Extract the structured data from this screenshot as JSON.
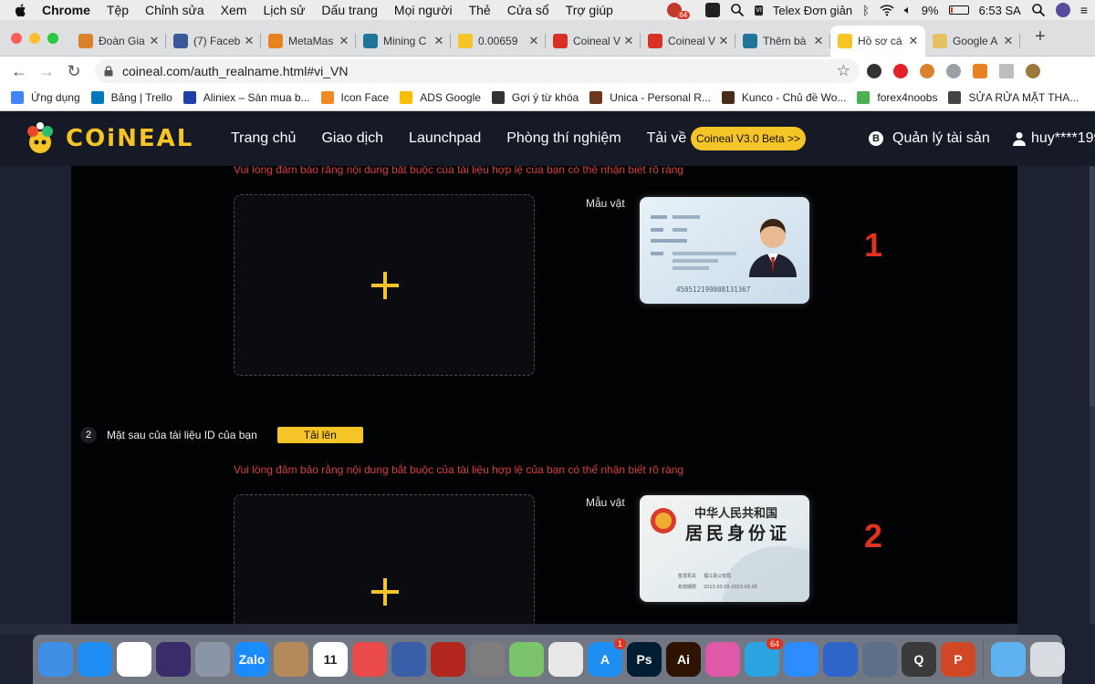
{
  "menubar": {
    "app_name": "Chrome",
    "items": [
      "Tệp",
      "Chỉnh sửa",
      "Xem",
      "Lịch sử",
      "Dấu trang",
      "Mọi người",
      "Thẻ",
      "Cửa sổ",
      "Trợ giúp"
    ],
    "notification_badge": "64",
    "input_method": "Telex Đơn giản",
    "input_badge": "VI",
    "battery": "9%",
    "clock": "6:53 SA"
  },
  "tabs": [
    {
      "title": "Đoàn Gia",
      "icon": "trello-icon",
      "color": "#d9822b",
      "active": false
    },
    {
      "title": "(7) Faceb",
      "icon": "facebook-icon",
      "color": "#3b5998",
      "active": false
    },
    {
      "title": "MetaMas",
      "icon": "metamask-icon",
      "color": "#e8821e",
      "active": false
    },
    {
      "title": "Mining C",
      "icon": "wordpress-icon",
      "color": "#21759b",
      "active": false
    },
    {
      "title": "0.00659",
      "icon": "bolt-icon",
      "color": "#f5c426",
      "active": false
    },
    {
      "title": "Coineal V",
      "icon": "gmail-icon",
      "color": "#d93025",
      "active": false
    },
    {
      "title": "Coineal V",
      "icon": "gmail-icon",
      "color": "#d93025",
      "active": false
    },
    {
      "title": "Thêm bà",
      "icon": "wordpress-icon",
      "color": "#21759b",
      "active": false
    },
    {
      "title": "Hồ sơ cá",
      "icon": "bolt-icon",
      "color": "#f5c426",
      "active": true
    },
    {
      "title": "Google A",
      "icon": "google-ads-icon",
      "color": "#e6c063",
      "active": false
    }
  ],
  "address_bar": {
    "url": "coineal.com/auth_realname.html#vi_VN"
  },
  "bookmarks": [
    {
      "label": "Ứng dụng",
      "icon": "apps-grid-icon",
      "color": "#4285f4"
    },
    {
      "label": "Bảng | Trello",
      "icon": "trello-icon",
      "color": "#0079bf"
    },
    {
      "label": "Aliniex – Sàn mua b...",
      "icon": "aliniex-icon",
      "color": "#1f3fa8"
    },
    {
      "label": "Icon Face",
      "icon": "smiley-icon",
      "color": "#f08a24"
    },
    {
      "label": "ADS Google",
      "icon": "google-ads-icon",
      "color": "#fbbc04"
    },
    {
      "label": "Gợi ý từ khóa",
      "icon": "spy-icon",
      "color": "#333333"
    },
    {
      "label": "Unica - Personal R...",
      "icon": "unica-icon",
      "color": "#6b3a1e"
    },
    {
      "label": "Kunco - Chủ đề Wo...",
      "icon": "kunco-icon",
      "color": "#4a2c1a"
    },
    {
      "label": "forex4noobs",
      "icon": "leaf-icon",
      "color": "#4caf50"
    },
    {
      "label": "SỬA RỬA MẶT THA...",
      "icon": "sanity-icon",
      "color": "#444444"
    }
  ],
  "site": {
    "logo_text": "COiNEAL",
    "nav": [
      "Trang chủ",
      "Giao dịch",
      "Launchpad",
      "Phòng thí nghiệm",
      "Tải về"
    ],
    "beta_button": "Coineal V3.0 Beta >>",
    "assets_link": "Quản lý tài sản",
    "btc_symbol": "B",
    "user_name": "huy****199"
  },
  "form": {
    "warning_text": "Vui lòng đảm bảo rằng nội dung bắt buộc của tài liệu hợp lệ của bạn có thể nhận biết rõ ràng",
    "sample_label": "Mẫu vật",
    "step1_marker": "1",
    "step2": {
      "number": "2",
      "label": "Mặt sau của tài liệu ID của bạn",
      "upload_button": "Tải lên",
      "marker": "2"
    },
    "front_card": {
      "number": "450512199808131367"
    },
    "back_card": {
      "country": "中华人民共和国",
      "title": "居民身份证",
      "issuer_label": "签发机关",
      "valid_label": "有效期限",
      "issuer": "福江县公安局",
      "valid": "2013.03.05-2023.03.05"
    }
  },
  "dock": [
    {
      "name": "finder-icon",
      "color": "#3f8fe6",
      "glyph": ""
    },
    {
      "name": "safari-icon",
      "color": "#1e8ef3",
      "glyph": ""
    },
    {
      "name": "chrome-icon",
      "color": "#ffffff",
      "glyph": ""
    },
    {
      "name": "siri-icon",
      "color": "#3a2b6b",
      "glyph": ""
    },
    {
      "name": "launchpad-icon",
      "color": "#8a96a8",
      "glyph": ""
    },
    {
      "name": "zalo-icon",
      "color": "#1a8cff",
      "glyph": "Zalo"
    },
    {
      "name": "keyboard-viewer-icon",
      "color": "#b48a5a",
      "glyph": ""
    },
    {
      "name": "calendar-icon",
      "color": "#ffffff",
      "glyph": "11"
    },
    {
      "name": "chat-app-icon",
      "color": "#e94b4b",
      "glyph": ""
    },
    {
      "name": "screen-share-icon",
      "color": "#3a5fa8",
      "glyph": ""
    },
    {
      "name": "photo-booth-icon",
      "color": "#b3261e",
      "glyph": ""
    },
    {
      "name": "system-preferences-icon",
      "color": "#7d7d7d",
      "glyph": ""
    },
    {
      "name": "maps-icon",
      "color": "#7cc46b",
      "glyph": ""
    },
    {
      "name": "preview-icon",
      "color": "#e8e8e8",
      "glyph": ""
    },
    {
      "name": "app-store-icon",
      "color": "#1e8ef3",
      "glyph": "A",
      "badge": "1"
    },
    {
      "name": "photoshop-icon",
      "color": "#001d34",
      "glyph": "Ps"
    },
    {
      "name": "illustrator-icon",
      "color": "#2d1300",
      "glyph": "Ai"
    },
    {
      "name": "cleanmymac-icon",
      "color": "#e058a8",
      "glyph": ""
    },
    {
      "name": "telegram-icon",
      "color": "#2aa3e0",
      "glyph": "",
      "badge": "64"
    },
    {
      "name": "zoom-icon",
      "color": "#2d8cff",
      "glyph": ""
    },
    {
      "name": "network-icon",
      "color": "#2f64c8",
      "glyph": ""
    },
    {
      "name": "screenshot-icon",
      "color": "#5c6f88",
      "glyph": ""
    },
    {
      "name": "quicktime-icon",
      "color": "#3a3a3a",
      "glyph": "Q"
    },
    {
      "name": "powerpoint-icon",
      "color": "#d24726",
      "glyph": "P"
    },
    {
      "name": "folder-icon",
      "color": "#5fb2f0",
      "glyph": ""
    },
    {
      "name": "trash-icon",
      "color": "#d9dde2",
      "glyph": ""
    }
  ]
}
